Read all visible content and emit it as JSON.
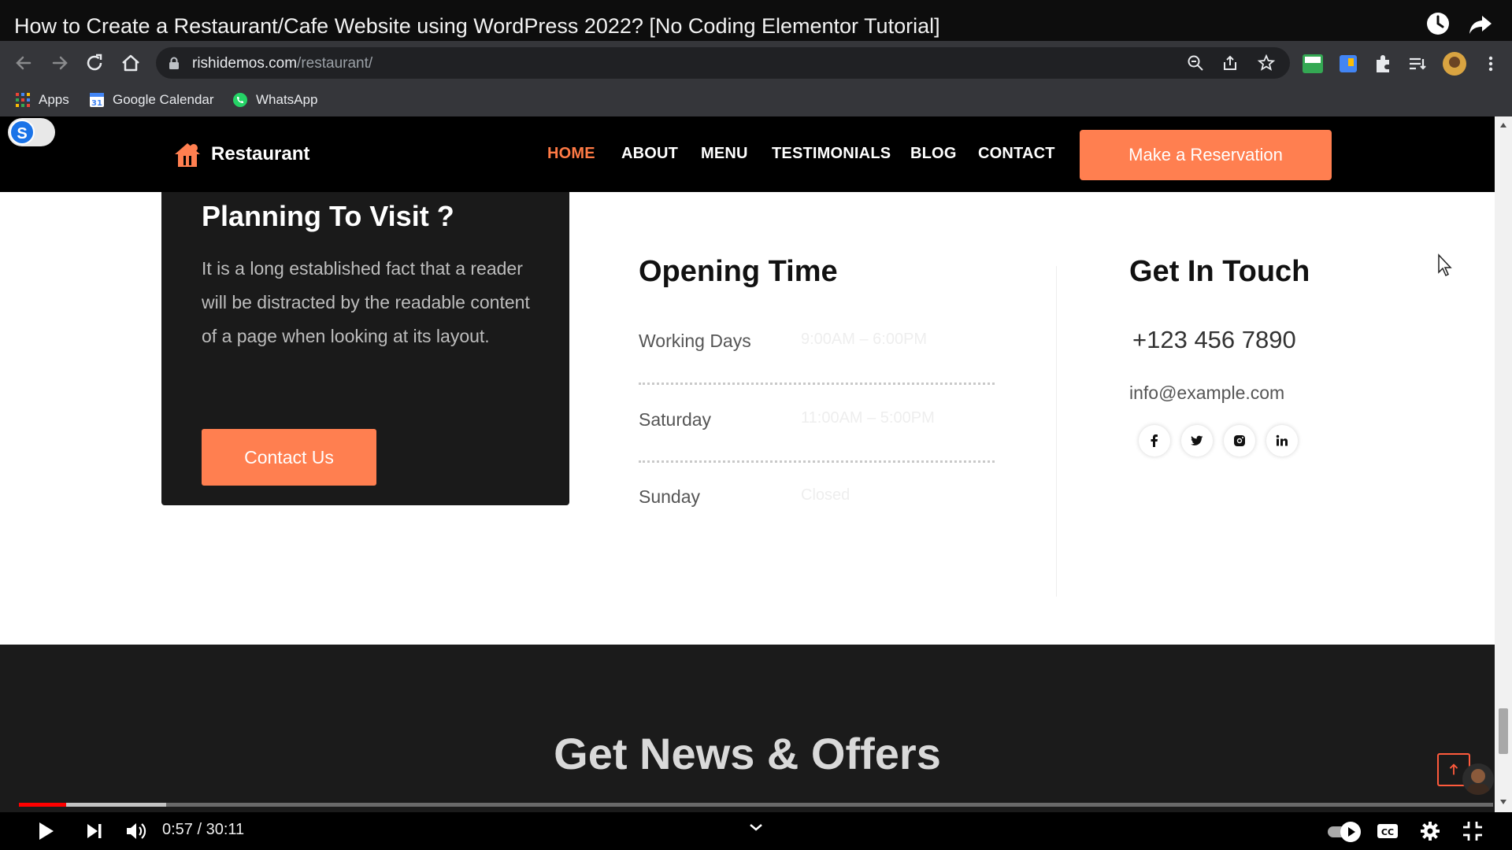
{
  "video": {
    "title": "How to Create a Restaurant/Cafe Website using WordPress 2022? [No Coding Elementor Tutorial]",
    "time_display": "0:57 / 30:11",
    "progress_fraction": 0.032,
    "buffer_fraction": 0.1
  },
  "browser": {
    "url_host": "rishidemos.com",
    "url_path": "/restaurant/",
    "bookmarks": [
      {
        "label": "Apps",
        "icon": "apps-grid-icon"
      },
      {
        "label": "Google Calendar",
        "icon": "google-calendar-icon"
      },
      {
        "label": "WhatsApp",
        "icon": "whatsapp-icon"
      }
    ]
  },
  "site": {
    "brand": "Restaurant",
    "nav": [
      "HOME",
      "ABOUT",
      "MENU",
      "TESTIMONIALS",
      "BLOG",
      "CONTACT"
    ],
    "active_nav": "HOME",
    "cta": "Make a Reservation",
    "toggle_letter": "S",
    "visit": {
      "title": "Planning To Visit ?",
      "body": "It is a long established fact that a reader will be distracted by the readable content of a page when looking at its layout.",
      "button": "Contact Us"
    },
    "opening": {
      "title": "Opening Time",
      "rows": [
        {
          "day": "Working Days",
          "time": "9:00AM – 6:00PM"
        },
        {
          "day": "Saturday",
          "time": "11:00AM – 5:00PM"
        },
        {
          "day": "Sunday",
          "time": "Closed"
        }
      ]
    },
    "touch": {
      "title": "Get In Touch",
      "phone": "+123 456 7890",
      "email": "info@example.com",
      "social": [
        "facebook-icon",
        "twitter-icon",
        "instagram-icon",
        "linkedin-icon"
      ]
    },
    "news_title": "Get News & Offers"
  },
  "colors": {
    "accent": "#ff7f50",
    "header_bg": "#000000",
    "card_bg": "#1a1a1a",
    "progress_red": "#ff0000"
  }
}
